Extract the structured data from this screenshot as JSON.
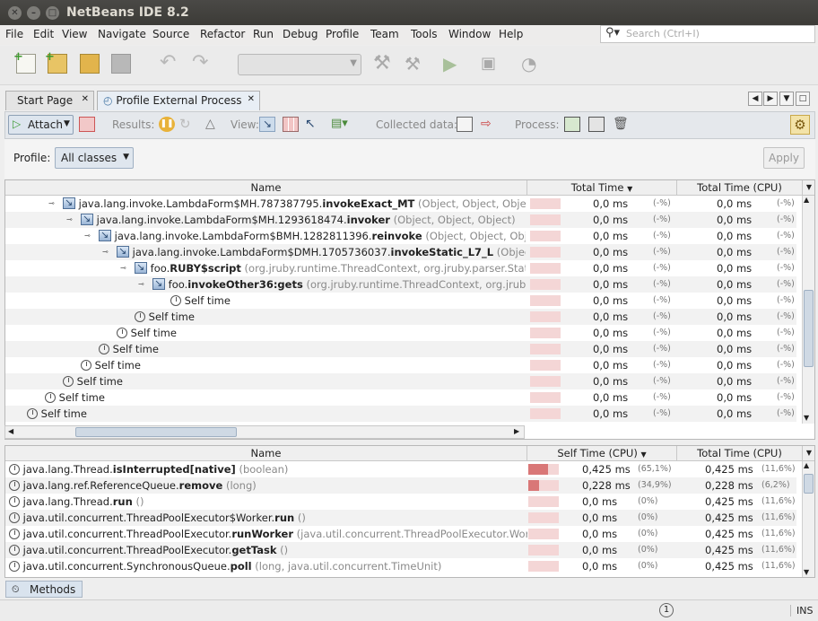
{
  "window": {
    "title": "NetBeans IDE 8.2"
  },
  "menu": {
    "items": [
      "File",
      "Edit",
      "View",
      "Navigate",
      "Source",
      "Refactor",
      "Run",
      "Debug",
      "Profile",
      "Team",
      "Tools",
      "Window",
      "Help"
    ]
  },
  "search": {
    "placeholder": "Search (Ctrl+I)"
  },
  "tabs": [
    {
      "label": "Start Page"
    },
    {
      "label": "Profile External Process"
    }
  ],
  "profiler_toolbar": {
    "attach": "Attach",
    "results": "Results:",
    "view": "View:",
    "collected": "Collected data:",
    "process": "Process:"
  },
  "profile": {
    "label": "Profile:",
    "value": "All classes",
    "apply": "Apply"
  },
  "top_table": {
    "headers": {
      "name": "Name",
      "total_time": "Total Time",
      "total_cpu": "Total Time (CPU)"
    },
    "rows": [
      {
        "prefix": "java.lang.invoke.LambdaForm$MH.787387795.",
        "method": "invokeExact_MT",
        "args": " (Object, Object, Object)",
        "time": "0,0 ms",
        "pct": "(-%)",
        "cpu": "0,0 ms",
        "cpct": "(-%)"
      },
      {
        "prefix": "java.lang.invoke.LambdaForm$MH.1293618474.",
        "method": "invoker",
        "args": " (Object, Object, Object)",
        "time": "0,0 ms",
        "pct": "(-%)",
        "cpu": "0,0 ms",
        "cpct": "(-%)"
      },
      {
        "prefix": "java.lang.invoke.LambdaForm$BMH.1282811396.",
        "method": "reinvoke",
        "args": " (Object, Object, Object)",
        "time": "0,0 ms",
        "pct": "(-%)",
        "cpu": "0,0 ms",
        "cpct": "(-%)"
      },
      {
        "prefix": "java.lang.invoke.LambdaForm$DMH.1705736037.",
        "method": "invokeStatic_L7_L",
        "args": " (Object, Object)",
        "time": "0,0 ms",
        "pct": "(-%)",
        "cpu": "0,0 ms",
        "cpct": "(-%)"
      },
      {
        "prefix": "foo.",
        "method": "RUBY$script",
        "args": " (org.jruby.runtime.ThreadContext, org.jruby.parser.StaticScope)",
        "time": "0,0 ms",
        "pct": "(-%)",
        "cpu": "0,0 ms",
        "cpct": "(-%)"
      },
      {
        "prefix": "foo.",
        "method": "invokeOther36:gets",
        "args": " (org.jruby.runtime.ThreadContext, org.jruby.runtime.builtin)",
        "time": "0,0 ms",
        "pct": "(-%)",
        "cpu": "0,0 ms",
        "cpct": "(-%)"
      },
      {
        "prefix": "Self time",
        "method": "",
        "args": "",
        "time": "0,0 ms",
        "pct": "(-%)",
        "cpu": "0,0 ms",
        "cpct": "(-%)"
      },
      {
        "prefix": "Self time",
        "method": "",
        "args": "",
        "time": "0,0 ms",
        "pct": "(-%)",
        "cpu": "0,0 ms",
        "cpct": "(-%)"
      },
      {
        "prefix": "Self time",
        "method": "",
        "args": "",
        "time": "0,0 ms",
        "pct": "(-%)",
        "cpu": "0,0 ms",
        "cpct": "(-%)"
      },
      {
        "prefix": "Self time",
        "method": "",
        "args": "",
        "time": "0,0 ms",
        "pct": "(-%)",
        "cpu": "0,0 ms",
        "cpct": "(-%)"
      },
      {
        "prefix": "Self time",
        "method": "",
        "args": "",
        "time": "0,0 ms",
        "pct": "(-%)",
        "cpu": "0,0 ms",
        "cpct": "(-%)"
      },
      {
        "prefix": "Self time",
        "method": "",
        "args": "",
        "time": "0,0 ms",
        "pct": "(-%)",
        "cpu": "0,0 ms",
        "cpct": "(-%)"
      },
      {
        "prefix": "Self time",
        "method": "",
        "args": "",
        "time": "0,0 ms",
        "pct": "(-%)",
        "cpu": "0,0 ms",
        "cpct": "(-%)"
      },
      {
        "prefix": "Self time",
        "method": "",
        "args": "",
        "time": "0,0 ms",
        "pct": "(-%)",
        "cpu": "0,0 ms",
        "cpct": "(-%)"
      }
    ]
  },
  "bottom_table": {
    "headers": {
      "name": "Name",
      "self_cpu": "Self Time (CPU)",
      "total_cpu": "Total Time (CPU)"
    },
    "rows": [
      {
        "prefix": "java.lang.Thread.",
        "method": "isInterrupted[native]",
        "args": " (boolean)",
        "self": "0,425 ms",
        "spct": "(65,1%)",
        "fill": 0.651,
        "total": "0,425 ms",
        "tpct": "(11,6%)"
      },
      {
        "prefix": "java.lang.ref.ReferenceQueue.",
        "method": "remove",
        "args": " (long)",
        "self": "0,228 ms",
        "spct": "(34,9%)",
        "fill": 0.349,
        "total": "0,228 ms",
        "tpct": "(6,2%)"
      },
      {
        "prefix": "java.lang.Thread.",
        "method": "run",
        "args": " ()",
        "self": "0,0 ms",
        "spct": "(0%)",
        "fill": 0,
        "total": "0,425 ms",
        "tpct": "(11,6%)"
      },
      {
        "prefix": "java.util.concurrent.ThreadPoolExecutor$Worker.",
        "method": "run",
        "args": " ()",
        "self": "0,0 ms",
        "spct": "(0%)",
        "fill": 0,
        "total": "0,425 ms",
        "tpct": "(11,6%)"
      },
      {
        "prefix": "java.util.concurrent.ThreadPoolExecutor.",
        "method": "runWorker",
        "args": " (java.util.concurrent.ThreadPoolExecutor.Worker)",
        "self": "0,0 ms",
        "spct": "(0%)",
        "fill": 0,
        "total": "0,425 ms",
        "tpct": "(11,6%)"
      },
      {
        "prefix": "java.util.concurrent.ThreadPoolExecutor.",
        "method": "getTask",
        "args": " ()",
        "self": "0,0 ms",
        "spct": "(0%)",
        "fill": 0,
        "total": "0,425 ms",
        "tpct": "(11,6%)"
      },
      {
        "prefix": "java.util.concurrent.SynchronousQueue.",
        "method": "poll",
        "args": " (long, java.util.concurrent.TimeUnit)",
        "self": "0,0 ms",
        "spct": "(0%)",
        "fill": 0,
        "total": "0,425 ms",
        "tpct": "(11,6%)"
      }
    ]
  },
  "bottom_tab": {
    "label": "Methods"
  },
  "status": {
    "mode": "INS",
    "notifications": "1"
  }
}
